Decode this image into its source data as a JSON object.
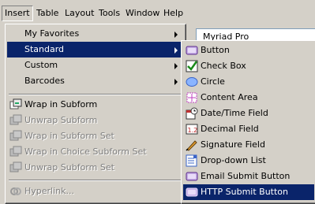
{
  "menubar": {
    "items": [
      {
        "label": "Insert",
        "u": "I"
      },
      {
        "label": "Table",
        "u": "a"
      },
      {
        "label": "Layout",
        "u": "L"
      },
      {
        "label": "Tools",
        "u": "T"
      },
      {
        "label": "Window",
        "u": "W"
      },
      {
        "label": "Help",
        "u": "H"
      }
    ]
  },
  "font_field": {
    "value": "Myriad Pro"
  },
  "insert_menu": {
    "items": [
      {
        "label": "My Favorites",
        "submenu": true
      },
      {
        "label": "Standard",
        "submenu": true,
        "highlighted": true
      },
      {
        "label": "Custom",
        "submenu": true
      },
      {
        "label": "Barcodes",
        "submenu": true
      },
      {
        "label": "Wrap in Subform"
      },
      {
        "label": "Unwrap Subform",
        "disabled": true
      },
      {
        "label": "Wrap in Subform Set",
        "disabled": true
      },
      {
        "label": "Wrap in Choice Subform Set",
        "disabled": true
      },
      {
        "label": "Unwrap Subform Set",
        "disabled": true
      },
      {
        "label": "Hyperlink...",
        "disabled": true
      }
    ]
  },
  "standard_menu": {
    "items": [
      {
        "label": "Button",
        "icon": "button-icon"
      },
      {
        "label": "Check Box",
        "icon": "checkbox-icon"
      },
      {
        "label": "Circle",
        "icon": "circle-icon"
      },
      {
        "label": "Content Area",
        "icon": "content-area-icon"
      },
      {
        "label": "Date/Time Field",
        "icon": "datetime-field-icon"
      },
      {
        "label": "Decimal Field",
        "icon": "decimal-field-icon"
      },
      {
        "label": "Signature Field",
        "icon": "signature-field-icon"
      },
      {
        "label": "Drop-down List",
        "icon": "dropdown-list-icon"
      },
      {
        "label": "Email Submit Button",
        "icon": "email-submit-button-icon"
      },
      {
        "label": "HTTP Submit Button",
        "icon": "http-submit-button-icon",
        "highlighted": true
      }
    ]
  },
  "colors": {
    "menu_bg": "#d4d0c8",
    "highlight": "#0a246a",
    "disabled": "#808080"
  }
}
